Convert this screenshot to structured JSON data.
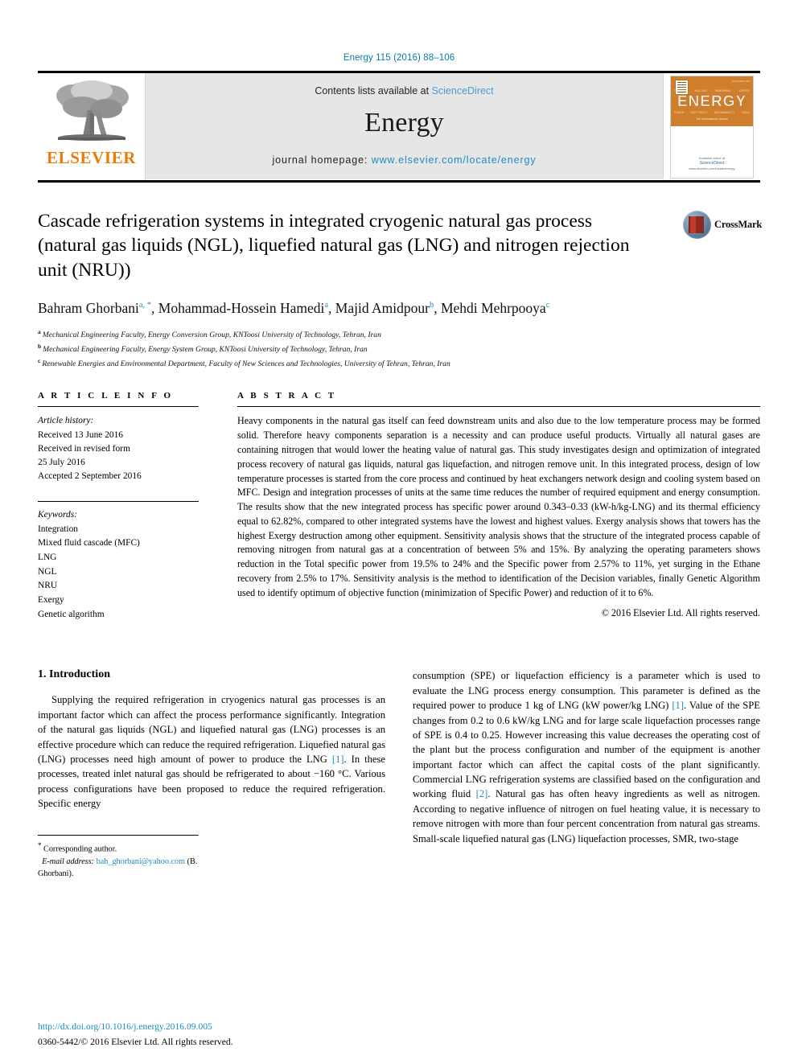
{
  "running_head": "Energy 115 (2016) 88–106",
  "masthead": {
    "publisher_name": "ELSEVIER",
    "contents_prefix": "Contents lists available at",
    "contents_link": "ScienceDirect",
    "journal_name": "Energy",
    "homepage_prefix": "journal homepage:",
    "homepage_url": "www.elsevier.com/locate/energy",
    "cover": {
      "title": "ENERGY",
      "issn_top": "ISSN 0360-5442",
      "row_top": [
        "THERMAL",
        "NUCLEAR",
        "RENEWABLE",
        "EXERGY"
      ],
      "row_bottom": [
        "POWER",
        "ELECTRICITY",
        "SUSTAINABILITY",
        "FUELS"
      ],
      "subtitle": "The International Journal",
      "foot_prefix": "Available online at",
      "foot_brand": "ScienceDirect",
      "foot_url": "www.elsevier.com/locate/energy"
    }
  },
  "article": {
    "title": "Cascade refrigeration systems in integrated cryogenic natural gas process (natural gas liquids (NGL), liquefied natural gas (LNG) and nitrogen rejection unit (NRU))",
    "crossmark_label": "CrossMark",
    "authors": [
      {
        "name": "Bahram Ghorbani",
        "marks": "a, *",
        "sep": ", "
      },
      {
        "name": "Mohammad-Hossein Hamedi",
        "marks": "a",
        "sep": ", "
      },
      {
        "name": "Majid Amidpour",
        "marks": "b",
        "sep": ", "
      },
      {
        "name": "Mehdi Mehrpooya",
        "marks": "c",
        "sep": ""
      }
    ],
    "affiliations": [
      {
        "label": "a",
        "text": "Mechanical Engineering Faculty, Energy Conversion Group, KNToosi University of Technology, Tehran, Iran"
      },
      {
        "label": "b",
        "text": "Mechanical Engineering Faculty, Energy System Group, KNToosi University of Technology, Tehran, Iran"
      },
      {
        "label": "c",
        "text": "Renewable Energies and Environmental Department, Faculty of New Sciences and Technologies, University of Tehran, Tehran, Iran"
      }
    ]
  },
  "article_info": {
    "heading": "A R T I C L E   I N F O",
    "history_label": "Article history:",
    "history": [
      "Received 13 June 2016",
      "Received in revised form",
      "25 July 2016",
      "Accepted 2 September 2016"
    ],
    "keywords_label": "Keywords:",
    "keywords": [
      "Integration",
      "Mixed fluid cascade (MFC)",
      "LNG",
      "NGL",
      "NRU",
      "Exergy",
      "Genetic algorithm"
    ]
  },
  "abstract": {
    "heading": "A B S T R A C T",
    "text": "Heavy components in the natural gas itself can feed downstream units and also due to the low temperature process may be formed solid. Therefore heavy components separation is a necessity and can produce useful products. Virtually all natural gases are containing nitrogen that would lower the heating value of natural gas. This study investigates design and optimization of integrated process recovery of natural gas liquids, natural gas liquefaction, and nitrogen remove unit. In this integrated process, design of low temperature processes is started from the core process and continued by heat exchangers network design and cooling system based on MFC. Design and integration processes of units at the same time reduces the number of required equipment and energy consumption. The results show that the new integrated process has specific power around 0.343–0.33 (kW-h/kg-LNG) and its thermal efficiency equal to 62.82%, compared to other integrated systems have the lowest and highest values. Exergy analysis shows that towers has the highest Exergy destruction among other equipment. Sensitivity analysis shows that the structure of the integrated process capable of removing nitrogen from natural gas at a concentration of between 5% and 15%. By analyzing the operating parameters shows reduction in the Total specific power from 19.5% to 24% and the Specific power from 2.57% to 11%, yet surging in the Ethane recovery from 2.5% to 17%. Sensitivity analysis is the method to identification of the Decision variables, finally Genetic Algorithm used to identify optimum of objective function (minimization of Specific Power) and reduction of it to 6%.",
    "copyright": "© 2016 Elsevier Ltd. All rights reserved."
  },
  "introduction": {
    "section_number_title": "1.  Introduction",
    "left_paragraph_a": "Supplying the required refrigeration in cryogenics natural gas processes is an important factor which can affect the process performance significantly. Integration of the natural gas liquids (NGL) and liquefied natural gas (LNG) processes is an effective procedure which can reduce the required refrigeration. Liquefied natural gas (LNG) processes need high amount of power to produce the LNG ",
    "left_ref_1": "[1]",
    "left_paragraph_b": ". In these processes, treated inlet natural gas should be refrigerated to about −160 °C. Various process configurations have been proposed to reduce the required refrigeration. Specific energy",
    "right_paragraph_a": "consumption (SPE) or liquefaction efficiency is a parameter which is used to evaluate the LNG process energy consumption. This parameter is defined as the required power to produce 1 kg of LNG (kW power/kg LNG) ",
    "right_ref_1": "[1]",
    "right_paragraph_b": ". Value of the SPE changes from 0.2 to 0.6 kW/kg LNG and for large scale liquefaction processes range of SPE is 0.4 to 0.25. However increasing this value decreases the operating cost of the plant but the process configuration and number of the equipment is another important factor which can affect the capital costs of the plant significantly. Commercial LNG refrigeration systems are classified based on the configuration and working fluid ",
    "right_ref_2": "[2]",
    "right_paragraph_c": ". Natural gas has often heavy ingredients as well as nitrogen. According to negative influence of nitrogen on fuel heating value, it is necessary to remove nitrogen with more than four percent concentration from natural gas streams. Small-scale liquefied natural gas (LNG) liquefaction processes, SMR, two-stage"
  },
  "footnote": {
    "corresponding_marker": "*",
    "corresponding_text": " Corresponding author.",
    "email_label": "E-mail address:",
    "email": "bah_ghorbani@yahoo.com",
    "email_suffix": "(B. Ghorbani)."
  },
  "footer": {
    "doi": "http://dx.doi.org/10.1016/j.energy.2016.09.005",
    "issn_line": "0360-5442/© 2016 Elsevier Ltd. All rights reserved."
  },
  "colors": {
    "link_blue": "#1f8bbd",
    "elsevier_orange": "#ec7a08",
    "masthead_gray": "#e6e6e6",
    "cover_orange": "#cf7e2c"
  }
}
